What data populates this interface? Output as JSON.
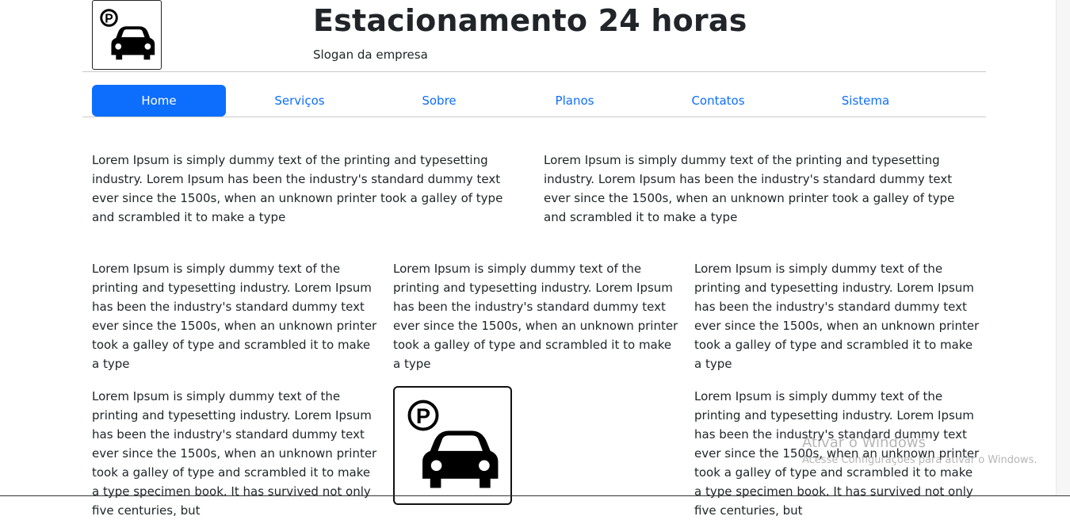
{
  "header": {
    "logo_icon": "parking-car-icon",
    "title": "Estacionamento 24 horas",
    "slogan": "Slogan da empresa"
  },
  "nav": {
    "items": [
      {
        "label": "Home",
        "active": true
      },
      {
        "label": "Serviços",
        "active": false
      },
      {
        "label": "Sobre",
        "active": false
      },
      {
        "label": "Planos",
        "active": false
      },
      {
        "label": "Contatos",
        "active": false
      },
      {
        "label": "Sistema",
        "active": false
      }
    ],
    "accent_color": "#0d6efd"
  },
  "content": {
    "row1": [
      "Lorem Ipsum is simply dummy text of the printing and typesetting industry. Lorem Ipsum has been the industry's standard dummy text ever since the 1500s, when an unknown printer took a galley of type and scrambled it to make a type",
      "Lorem Ipsum is simply dummy text of the printing and typesetting industry. Lorem Ipsum has been the industry's standard dummy text ever since the 1500s, when an unknown printer took a galley of type and scrambled it to make a type"
    ],
    "row2": [
      "Lorem Ipsum is simply dummy text of the printing and typesetting industry. Lorem Ipsum has been the industry's standard dummy text ever since the 1500s, when an unknown printer took a galley of type and scrambled it to make a type",
      "Lorem Ipsum is simply dummy text of the printing and typesetting industry. Lorem Ipsum has been the industry's standard dummy text ever since the 1500s, when an unknown printer took a galley of type and scrambled it to make a type",
      "Lorem Ipsum is simply dummy text of the printing and typesetting industry. Lorem Ipsum has been the industry's standard dummy text ever since the 1500s, when an unknown printer took a galley of type and scrambled it to make a type"
    ],
    "row3": {
      "left": "Lorem Ipsum is simply dummy text of the printing and typesetting industry. Lorem Ipsum has been the industry's standard dummy text ever since the 1500s, when an unknown printer took a galley of type and scrambled it to make a type specimen book. It has survived not only five centuries, but",
      "image_icon": "parking-car-icon",
      "right": "Lorem Ipsum is simply dummy text of the printing and typesetting industry. Lorem Ipsum has been the industry's standard dummy text ever since the 1500s, when an unknown printer took a galley of type and scrambled it to make a type specimen book. It has survived not only five centuries, but"
    }
  },
  "watermark": {
    "title": "Ativar o Windows",
    "subtitle": "Acesse Configurações para ativar o Windows."
  }
}
